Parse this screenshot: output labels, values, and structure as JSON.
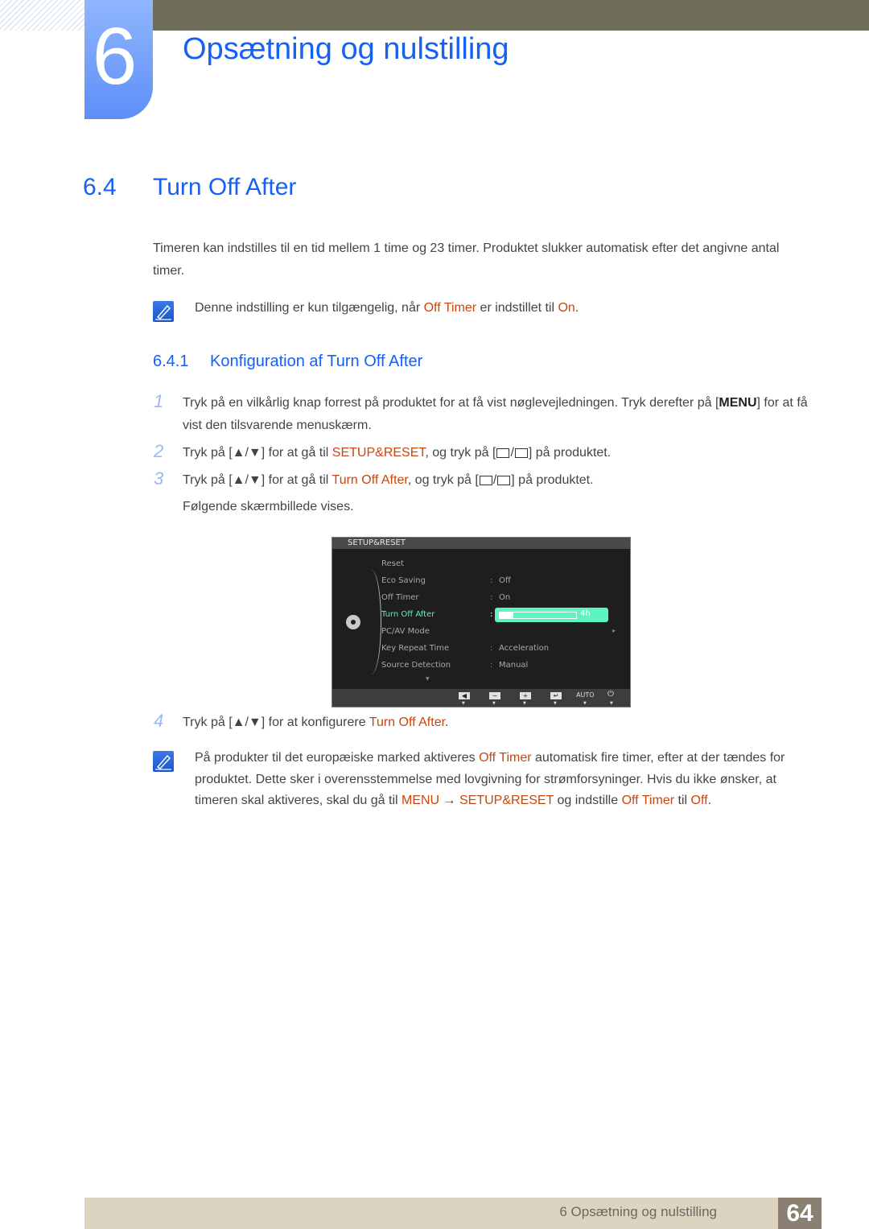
{
  "header": {
    "chapter_number": "6",
    "chapter_title": "Opsætning og nulstilling"
  },
  "section": {
    "number": "6.4",
    "title": "Turn Off After"
  },
  "intro": "Timeren kan indstilles til en tid mellem 1 time og 23 timer. Produktet slukker automatisk efter det angivne antal timer.",
  "note1": {
    "pre": "Denne indstilling er kun tilgængelig, når ",
    "hl1": "Off Timer",
    "mid": " er indstillet til ",
    "hl2": "On",
    "post": "."
  },
  "subsection": {
    "number": "6.4.1",
    "title": "Konfiguration af Turn Off After"
  },
  "steps": [
    {
      "num": "1",
      "pre": "Tryk på en vilkårlig knap forrest på produktet for at få vist nøglevejledningen. Tryk derefter på [",
      "key": "MENU",
      "post": "] for at få vist den tilsvarende menuskærm."
    },
    {
      "num": "2",
      "pre": "Tryk på [▲/▼] for at gå til ",
      "hl": "SETUP&RESET",
      "post": ", og tryk på [",
      "post2": "] på produktet."
    },
    {
      "num": "3",
      "pre": "Tryk på [▲/▼] for at gå til ",
      "hl": "Turn Off After",
      "post": ", og tryk på [",
      "post2": "] på produktet."
    },
    {
      "num": "4",
      "pre": "Tryk på [▲/▼] for at konfigurere ",
      "hl": "Turn Off After",
      "post": "."
    }
  ],
  "step3_followup": "Følgende skærmbillede vises.",
  "osd": {
    "title": "SETUP&RESET",
    "items": [
      {
        "label": "Reset",
        "value": ""
      },
      {
        "label": "Eco Saving",
        "value": "Off"
      },
      {
        "label": "Off Timer",
        "value": "On"
      },
      {
        "label": "Turn Off After",
        "value": "4h",
        "selected": true,
        "progress_hours": 4,
        "progress_max_hours": 23
      },
      {
        "label": "PC/AV Mode",
        "value": "▸"
      },
      {
        "label": "Key Repeat Time",
        "value": "Acceleration"
      },
      {
        "label": "Source Detection",
        "value": "Manual"
      }
    ],
    "buttons": [
      "◀",
      "−",
      "+",
      "↵",
      "AUTO",
      "⏻"
    ]
  },
  "note2": {
    "t1": "På produkter til det europæiske marked aktiveres ",
    "h1": "Off Timer",
    "t2": " automatisk fire timer, efter at der tændes for produktet. Dette sker i overensstemmelse med lovgivning for strømforsyninger. Hvis du ikke ønsker, at timeren skal aktiveres, skal du gå til ",
    "h2": "MENU",
    "arrow": " → ",
    "h3": "SETUP&RESET",
    "t3": " og indstille ",
    "h4": "Off Timer",
    "t4": " til ",
    "h5": "Off",
    "t5": "."
  },
  "footer": {
    "chapter": "6 Opsætning og nulstilling",
    "page": "64"
  }
}
